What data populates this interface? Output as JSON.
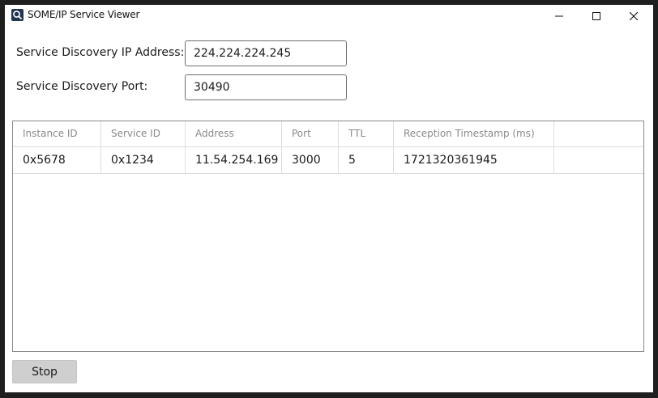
{
  "window": {
    "title": "SOME/IP Service Viewer",
    "icon": "magnifier-icon"
  },
  "form": {
    "ip_label": "Service Discovery IP Address:",
    "ip_value": "224.224.224.245",
    "port_label": "Service Discovery Port:",
    "port_value": "30490"
  },
  "table": {
    "columns": [
      "Instance ID",
      "Service ID",
      "Address",
      "Port",
      "TTL",
      "Reception Timestamp (ms)",
      ""
    ],
    "rows": [
      [
        "0x5678",
        "0x1234",
        "11.54.254.169",
        "3000",
        "5",
        "1721320361945",
        ""
      ]
    ]
  },
  "actions": {
    "stop_label": "Stop"
  },
  "colors": {
    "window_bg": "#ffffff",
    "frame": "#1f1f1f",
    "button_bg": "#cfcfcf",
    "icon_bg": "#1f3550"
  }
}
